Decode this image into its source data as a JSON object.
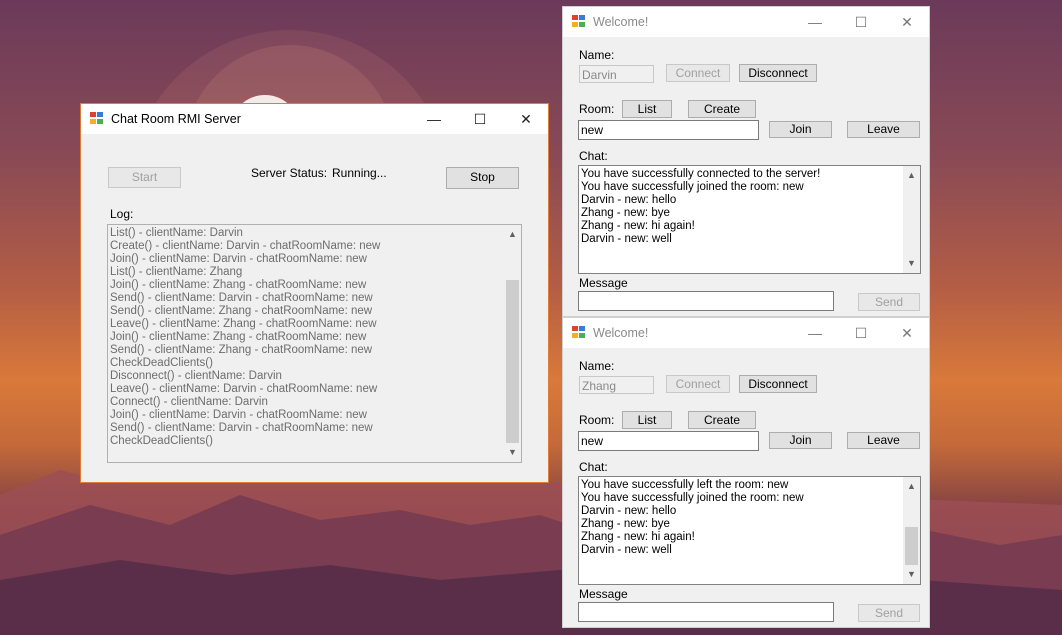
{
  "server": {
    "title": "Chat Room RMI Server",
    "start_label": "Start",
    "status_label": "Server Status:",
    "status_value": "Running...",
    "stop_label": "Stop",
    "log_label": "Log:",
    "log_lines": [
      "List()  - clientName: Darvin",
      "Create()  - clientName: Darvin - chatRoomName: new",
      "Join() - clientName: Darvin - chatRoomName: new",
      "List()  - clientName: Zhang",
      "Join() - clientName: Zhang - chatRoomName: new",
      "Send() - clientName: Darvin - chatRoomName: new",
      "Send() - clientName: Zhang - chatRoomName: new",
      "Leave() - clientName: Zhang - chatRoomName: new",
      "Join() - clientName: Zhang - chatRoomName: new",
      "Send() - clientName: Zhang - chatRoomName: new",
      "CheckDeadClients()",
      "Disconnect() - clientName: Darvin",
      "Leave() - clientName: Darvin - chatRoomName: new",
      "Connect() - clientName: Darvin",
      "Join() - clientName: Darvin - chatRoomName: new",
      "Send() - clientName: Darvin - chatRoomName: new",
      "CheckDeadClients()"
    ]
  },
  "clients": [
    {
      "title": "Welcome!",
      "name_label": "Name:",
      "name_value": "Darvin",
      "connect_label": "Connect",
      "disconnect_label": "Disconnect",
      "room_label": "Room:",
      "list_label": "List",
      "create_label": "Create",
      "room_value": "new",
      "join_label": "Join",
      "leave_label": "Leave",
      "chat_label": "Chat:",
      "chat_lines": [
        "You have successfully connected to the server!",
        "You have successfully joined the room: new",
        "Darvin - new: hello",
        "Zhang - new: bye",
        "Zhang - new: hi again!",
        "Darvin - new: well"
      ],
      "message_label": "Message",
      "message_value": "",
      "send_label": "Send"
    },
    {
      "title": "Welcome!",
      "name_label": "Name:",
      "name_value": "Zhang",
      "connect_label": "Connect",
      "disconnect_label": "Disconnect",
      "room_label": "Room:",
      "list_label": "List",
      "create_label": "Create",
      "room_value": "new",
      "join_label": "Join",
      "leave_label": "Leave",
      "chat_label": "Chat:",
      "chat_lines": [
        "You have successfully left the room: new",
        "You have successfully joined the room: new",
        "Darvin - new: hello",
        "Zhang - new: bye",
        "Zhang - new: hi again!",
        "Darvin - new: well"
      ],
      "message_label": "Message",
      "message_value": "",
      "send_label": "Send"
    }
  ],
  "window_controls": {
    "minimize": "—",
    "maximize": "☐",
    "close": "✕"
  },
  "scroll_arrows": {
    "up": "▲",
    "down": "▼"
  },
  "colors": {
    "accent_border": "#e07b39",
    "button_face": "#e1e1e1"
  },
  "icons": [
    "app-icon",
    "minimize-icon",
    "maximize-icon",
    "close-icon",
    "scroll-up-icon",
    "scroll-down-icon"
  ]
}
